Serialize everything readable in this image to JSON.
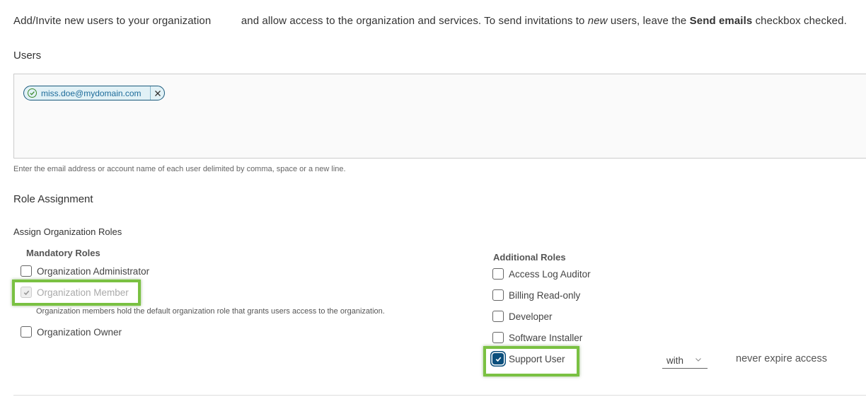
{
  "intro": {
    "part1": "Add/Invite new users to your organization",
    "part2": "and allow access to the organization and services. To send invitations to",
    "emphasis": "new",
    "part3": "users, leave the",
    "bold": "Send emails",
    "part4": "checkbox checked."
  },
  "users": {
    "label": "Users",
    "chips": [
      {
        "email": "miss.doe@mydomain.com",
        "status": "valid"
      }
    ],
    "helper": "Enter the email address or account name of each user delimited by comma, space or a new line."
  },
  "roles": {
    "heading": "Role Assignment",
    "assign_label": "Assign Organization Roles",
    "mandatory": {
      "title": "Mandatory Roles",
      "items": [
        {
          "label": "Organization Administrator",
          "checked": false,
          "disabled": false
        },
        {
          "label": "Organization Member",
          "checked": true,
          "disabled": true
        },
        {
          "label": "Organization Owner",
          "checked": false,
          "disabled": false
        }
      ],
      "member_description": "Organization members hold the default organization role that grants users access to the organization."
    },
    "additional": {
      "title": "Additional Roles",
      "items": [
        {
          "label": "Access Log Auditor",
          "checked": false
        },
        {
          "label": "Billing Read-only",
          "checked": false
        },
        {
          "label": "Developer",
          "checked": false
        },
        {
          "label": "Software Installer",
          "checked": false
        },
        {
          "label": "Support User",
          "checked": true
        }
      ],
      "support_select": "with",
      "support_expiry": "never expire access"
    }
  },
  "colors": {
    "highlight": "#7ac142",
    "checkbox_checked": "#0b4f7c",
    "chip_border": "#1a5a7c"
  }
}
